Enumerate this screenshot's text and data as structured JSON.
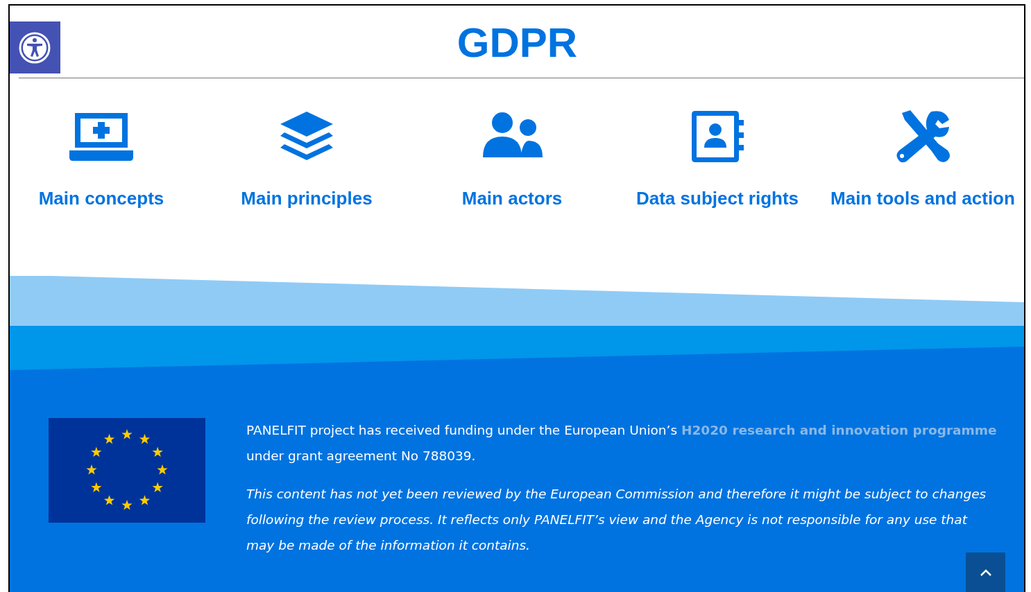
{
  "header": {
    "title": "GDPR"
  },
  "nav_items": [
    {
      "label": "Main concepts"
    },
    {
      "label": "Main principles"
    },
    {
      "label": "Main actors"
    },
    {
      "label": "Data subject rights"
    },
    {
      "label": "Main tools and action"
    }
  ],
  "footer": {
    "funding": {
      "text_before": "PANELFIT project has received funding under the European Union’s",
      "link": "H2020 research and innovation programme",
      "text_after": "under grant agreement No 788039."
    },
    "disclaimer": "This content has not yet been reviewed by the European Commission and therefore it might be subject to changes following the review process. It reflects only PANELFIT’s view and the Agency is not responsible for any use that may be made of the information it contains."
  }
}
